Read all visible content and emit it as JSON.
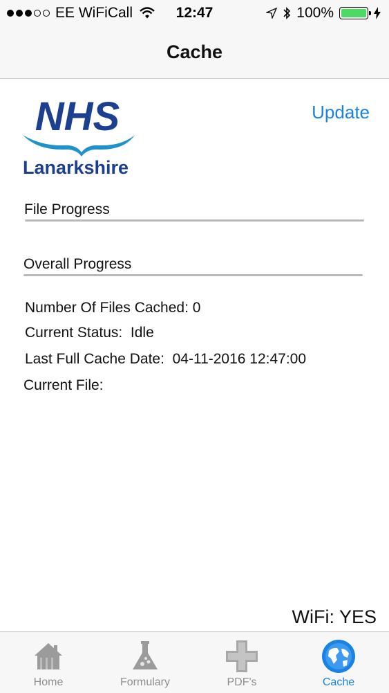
{
  "status_bar": {
    "carrier": "EE WiFiCall",
    "time": "12:47",
    "battery": "100%"
  },
  "nav": {
    "title": "Cache"
  },
  "header": {
    "logo_text": "NHS",
    "logo_subtext": "Lanarkshire",
    "update_label": "Update"
  },
  "progress": {
    "file_label": "File Progress",
    "file_value": 0,
    "overall_label": "Overall Progress",
    "overall_value": 0
  },
  "info": {
    "files_cached": "Number Of Files Cached: 0",
    "current_status": "Current Status:  Idle",
    "last_cache_date": "Last Full Cache Date:  04-11-2016 12:47:00",
    "current_file": "Current File:"
  },
  "wifi_status": "WiFi: YES",
  "tabs": [
    {
      "label": "Home",
      "icon": "home-icon"
    },
    {
      "label": "Formulary",
      "icon": "flask-icon"
    },
    {
      "label": "PDF's",
      "icon": "cross-icon"
    },
    {
      "label": "Cache",
      "icon": "globe-icon",
      "active": true
    }
  ],
  "colors": {
    "accent": "#1a82e2",
    "nhs_blue": "#1c3f8f",
    "wave_blue": "#1f93c9",
    "battery_green": "#4cd964"
  }
}
